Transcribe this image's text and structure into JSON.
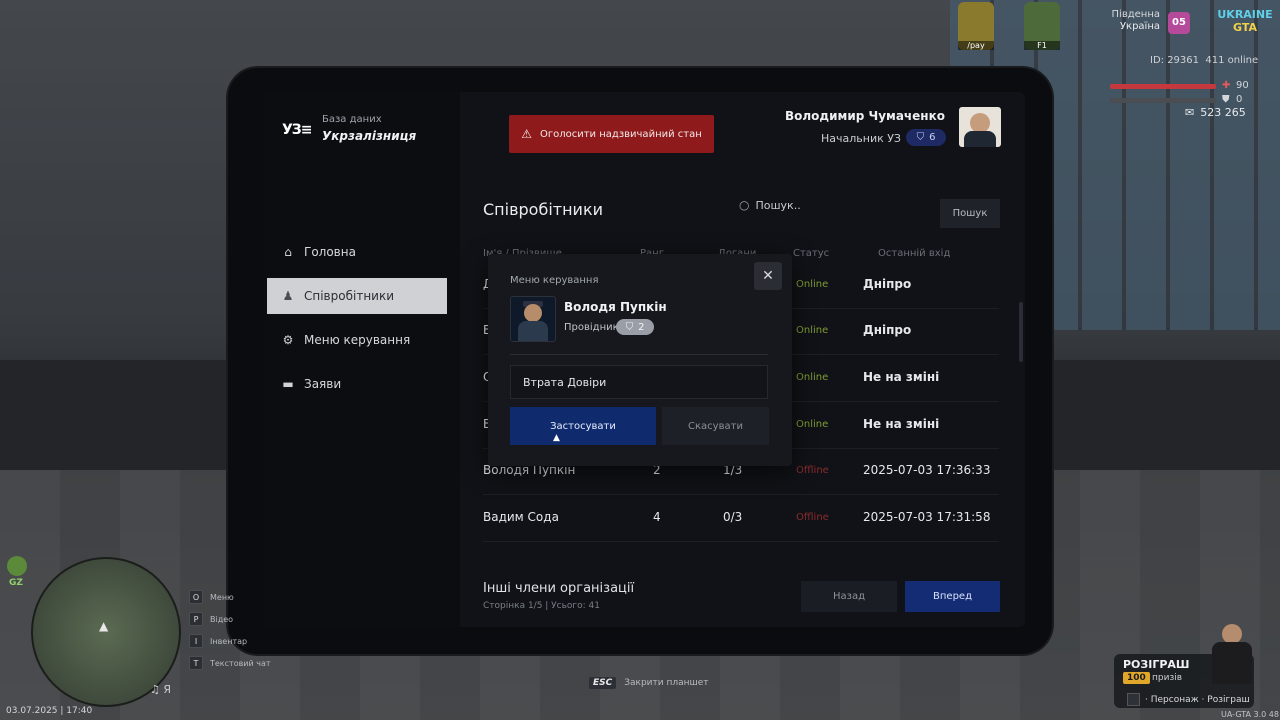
{
  "hud": {
    "region_line1": "Південна",
    "region_line2": "Україна",
    "car_pay": "/pay",
    "car_f1": "F1",
    "badge": "05",
    "logo_top": "UKRAINE",
    "logo_bottom": "GTA",
    "id_text": "ID: 29361",
    "online_text": "411 online",
    "health": "90",
    "armor": "0",
    "money": "523 265"
  },
  "tablet": {
    "logo_mark": "УЗ",
    "db_label": "База даних",
    "db_title": "Укрзалізниця",
    "alarm_label": "Оголосити надзвичайний стан",
    "user": {
      "name": "Володимир Чумаченко",
      "role": "Начальник УЗ",
      "level": "6"
    },
    "nav": [
      {
        "label": "Головна",
        "icon": "home-icon"
      },
      {
        "label": "Співробітники",
        "icon": "users-icon"
      },
      {
        "label": "Меню керування",
        "icon": "gear-icon"
      },
      {
        "label": "Заяви",
        "icon": "folder-icon"
      }
    ],
    "page_title": "Співробітники",
    "search_placeholder": "Пошук..",
    "search_button": "Пошук",
    "columns": [
      "Ім'я / Прізвище",
      "Ранг",
      "Догани",
      "Статус",
      "Останній вхід"
    ],
    "rows": [
      {
        "name": "Д",
        "rank": "",
        "warns": "",
        "status": "Online",
        "last": "Дніпро"
      },
      {
        "name": "В",
        "rank": "",
        "warns": "",
        "status": "Online",
        "last": "Дніпро"
      },
      {
        "name": "О",
        "rank": "",
        "warns": "",
        "status": "Online",
        "last": "Не на зміні"
      },
      {
        "name": "В",
        "rank": "",
        "warns": "",
        "status": "Online",
        "last": "Не на зміні"
      },
      {
        "name": "Володя Пупкін",
        "rank": "2",
        "warns": "1/3",
        "status": "Offline",
        "last": "2025-07-03 17:36:33"
      },
      {
        "name": "Вадим Сода",
        "rank": "4",
        "warns": "0/3",
        "status": "Offline",
        "last": "2025-07-03 17:31:58"
      }
    ],
    "others_title": "Інші члени організації",
    "others_sub": "Сторінка 1/5 | Усього: 41",
    "back_label": "Назад",
    "next_label": "Вперед"
  },
  "modal": {
    "header": "Меню керування",
    "name": "Володя Пупкін",
    "role": "Провідник",
    "level": "2",
    "input_value": "Втрата Довіри",
    "apply_label": "Застосувати",
    "cancel_label": "Скасувати"
  },
  "bottom": {
    "esc_key": "ESC",
    "esc_text": "Закрити планшет",
    "gz": "GZ",
    "keys": [
      {
        "key": "O",
        "text": "Меню"
      },
      {
        "key": "P",
        "text": "Відео"
      },
      {
        "key": "I",
        "text": "Інвентар"
      },
      {
        "key": "T",
        "text": "Текстовий чат"
      }
    ],
    "mic_key": "Я",
    "datetime": "03.07.2025 | 17:40",
    "giveaway_title": "РОЗІГРАШ",
    "giveaway_count": "100",
    "giveaway_prizes": "призів",
    "giveaway_foot": "· Персонаж · Розіграш",
    "version": "UA-GTA 3.0",
    "version_extra": "48"
  },
  "colors": {
    "accent_blue": "#142c73",
    "alarm_red": "#8f1a1c",
    "online_green": "#7f9c31",
    "offline_red": "#8a2b2b"
  }
}
